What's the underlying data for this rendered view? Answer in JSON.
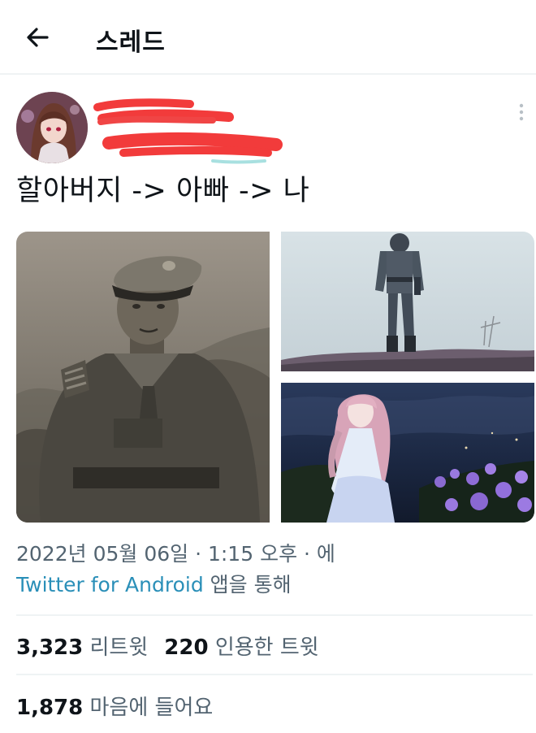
{
  "header": {
    "title": "스레드"
  },
  "tweet": {
    "text": "할아버지 -> 아빠 -> 나",
    "datetime": "2022년 05월 06일 · 1:15 오후 · 에",
    "source": "Twitter for Android",
    "source_suffix": "앱을 통해"
  },
  "stats": {
    "retweets_count": "3,323",
    "retweets_label": "리트윗",
    "quotes_count": "220",
    "quotes_label": "인용한 트윗",
    "likes_count": "1,878",
    "likes_label": "마음에 들어요"
  },
  "icons": {
    "back": "arrow-left-icon",
    "more": "vertical-dots-icon"
  },
  "colors": {
    "link": "#2a8fb8",
    "redaction": "#f23b3b",
    "muted_text": "#536471"
  }
}
